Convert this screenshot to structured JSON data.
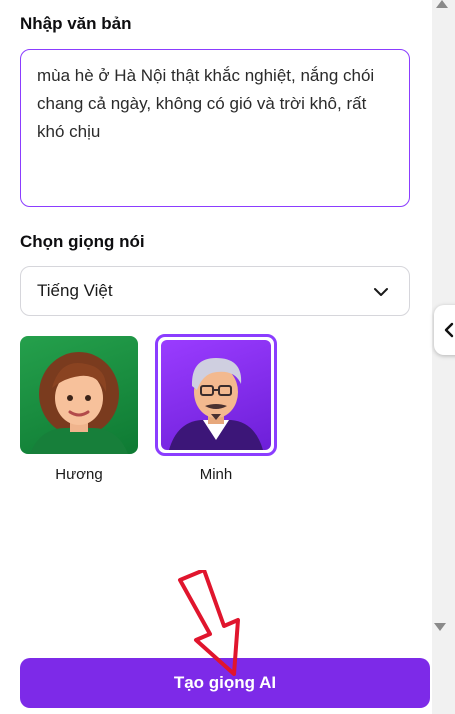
{
  "text_section": {
    "label": "Nhập văn bản",
    "value": "mùa hè ở Hà Nội thật khắc nghiệt, nắng chói chang cả ngày, không có gió và trời khô, rất khó chịu"
  },
  "voice_section": {
    "label": "Chọn giọng nói",
    "language_selected": "Tiếng Việt",
    "voices": [
      {
        "name": "Hương",
        "selected": false
      },
      {
        "name": "Minh",
        "selected": true
      }
    ]
  },
  "generate_button": {
    "label": "Tạo giọng AI"
  },
  "colors": {
    "accent": "#8b3dff",
    "button": "#7d2ae8",
    "annotation_arrow": "#e0152d"
  },
  "icons": [
    "chevron-down-icon",
    "chevron-left-icon",
    "scroll-up-arrow",
    "scroll-down-arrow",
    "annotation-arrow"
  ]
}
